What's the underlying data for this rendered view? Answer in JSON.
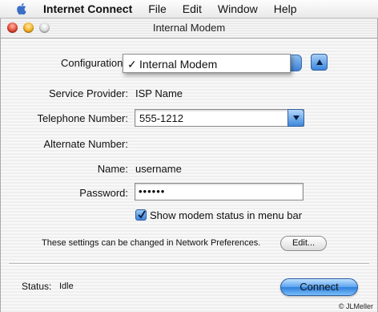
{
  "menubar": {
    "app_name": "Internet Connect",
    "items": [
      "File",
      "Edit",
      "Window",
      "Help"
    ]
  },
  "window": {
    "title": "Internal Modem"
  },
  "form": {
    "configuration_label": "Configuration:",
    "configuration_value": "Internal Modem",
    "configuration_check": "✓",
    "service_provider_label": "Service Provider:",
    "service_provider_value": "ISP Name",
    "telephone_label": "Telephone Number:",
    "telephone_value": "555-1212",
    "alternate_label": "Alternate Number:",
    "name_label": "Name:",
    "name_value": "username",
    "password_label": "Password:",
    "password_value": "••••••",
    "show_status_checked": true,
    "show_status_label": "Show modem status in menu bar",
    "info_text": "These settings can be changed in Network Preferences.",
    "edit_button_label": "Edit..."
  },
  "status": {
    "label": "Status:",
    "value": "Idle"
  },
  "connect_button_label": "Connect",
  "credit": "© JLMeller",
  "colors": {
    "accent_blue": "#3a84db",
    "close_red": "#e0432c",
    "minimize_yellow": "#f2ad1d"
  }
}
